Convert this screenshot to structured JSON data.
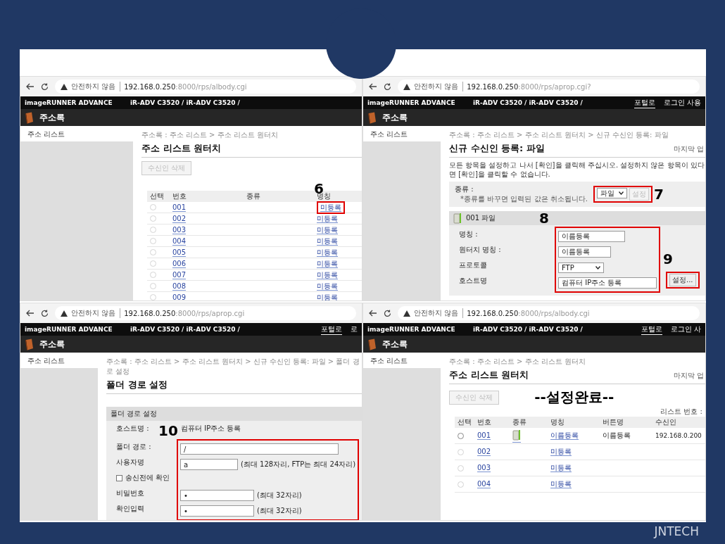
{
  "panels": [
    {
      "kind": "address_list",
      "browser": {
        "security": "안전하지 않음",
        "url_host": "192.168.0.250",
        "url_path": ":8000/rps/albody.cgi"
      },
      "header": {
        "product": "imageRUNNER ADVANCE",
        "device": "iR-ADV C3520 / iR-ADV C3520 /"
      },
      "app_title": "주소록",
      "sidebar_item": "주소 리스트",
      "breadcrumb": "주소록 : 주소 리스트 > 주소 리스트 원터치",
      "title": "주소 리스트 원터치",
      "delete_button": {
        "label": "수신인 삭제",
        "disabled": true
      },
      "columns": [
        "선택",
        "번호",
        "종류",
        "명칭"
      ],
      "rows": [
        {
          "number": "001",
          "name": "미등록",
          "disabled": true,
          "callout": "6"
        },
        {
          "number": "002",
          "name": "미등록",
          "disabled": true
        },
        {
          "number": "003",
          "name": "미등록",
          "disabled": true
        },
        {
          "number": "004",
          "name": "미등록",
          "disabled": true
        },
        {
          "number": "005",
          "name": "미등록",
          "disabled": true
        },
        {
          "number": "006",
          "name": "미등록",
          "disabled": true
        },
        {
          "number": "007",
          "name": "미등록",
          "disabled": true
        },
        {
          "number": "008",
          "name": "미등록",
          "disabled": true
        },
        {
          "number": "009",
          "name": "미등록",
          "disabled": true
        }
      ]
    },
    {
      "kind": "new_recipient",
      "browser": {
        "security": "안전하지 않음",
        "url_host": "192.168.0.250",
        "url_path": ":8000/rps/aprop.cgi?"
      },
      "header": {
        "product": "imageRUNNER ADVANCE",
        "device": "iR-ADV C3520 / iR-ADV C3520 /",
        "links": [
          "포털로",
          "로그인 사용"
        ]
      },
      "app_title": "주소록",
      "sidebar_item": "주소 리스트",
      "breadcrumb": "주소록 : 주소 리스트 > 주소 리스트 원터치 > 신규 수신인 등록: 파일",
      "title": "신규 수신인 등록: 파일",
      "last_update": "마지막 업",
      "instructions": "모든 항목을 설정하고 나서 [확인]을 클릭해 주십시오. 설정하지 않은 항목이 있다면 [확인]을 클릭할 수 없습니다.",
      "type_field": {
        "label": "종류 :",
        "note": "*종류를 바꾸면 입력된 값은 취소됩니다.",
        "value": "파일",
        "button": {
          "label": "설정",
          "disabled": true
        },
        "callout": "7"
      },
      "section_title": "001 파일",
      "fields_callout": "8",
      "fields": [
        {
          "kind": "input",
          "label": "명칭 :",
          "value": "이름등록"
        },
        {
          "kind": "input",
          "label": "원터치 명칭 :",
          "value": "이름등록"
        },
        {
          "kind": "select",
          "label": "프로토콜",
          "value": "FTP"
        },
        {
          "kind": "input",
          "label": "호스트명",
          "value": "컴퓨터 IP주소 등록"
        }
      ],
      "host_button": {
        "label": "설정...",
        "callout": "9"
      }
    },
    {
      "kind": "folder_path",
      "browser": {
        "security": "안전하지 않음",
        "url_host": "192.168.0.250",
        "url_path": ":8000/rps/aprop.cgi"
      },
      "header": {
        "product": "imageRUNNER ADVANCE",
        "device": "iR-ADV C3520 / iR-ADV C3520 /",
        "links": [
          "포털로",
          "로"
        ]
      },
      "app_title": "주소록",
      "sidebar_item": "주소 리스트",
      "breadcrumb": "주소록 : 주소 리스트 > 주소 리스트 원터치 > 신규 수신인 등록: 파일 > 폴더 경로 설정",
      "title": "폴더 경로 설정",
      "section_title": "폴더 경로 설정",
      "host_label": "호스트명 :",
      "host_value": "컴퓨터 IP주소 등록",
      "fields_callout": "10",
      "fields": [
        {
          "kind": "input",
          "label": "폴더 경로 :",
          "value": "/"
        },
        {
          "kind": "input",
          "label": "사용자명",
          "value": "a",
          "note": "(최대 128자리, FTP는 최대 24자리)"
        },
        {
          "kind": "checkbox",
          "label": "송신전에 확인",
          "checked": false
        },
        {
          "kind": "password",
          "label": "비밀번호",
          "value": "•",
          "note": "(최대 32자리)"
        },
        {
          "kind": "password",
          "label": "확인입력",
          "value": "•",
          "note": "(최대 32자리)"
        }
      ]
    },
    {
      "kind": "address_list",
      "browser": {
        "security": "안전하지 않음",
        "url_host": "192.168.0.250",
        "url_path": ":8000/rps/albody.cgi"
      },
      "header": {
        "product": "imageRUNNER ADVANCE",
        "device": "iR-ADV C3520 / iR-ADV C3520 /",
        "links": [
          "포털로",
          "로그인 사"
        ]
      },
      "app_title": "주소록",
      "sidebar_item": "주소 리스트",
      "breadcrumb": "주소록 : 주소 리스트 > 주소 리스트 원터치",
      "title": "주소 리스트 원터치",
      "last_update": "마지막 업",
      "delete_button": {
        "label": "수신인 삭제",
        "disabled": true
      },
      "banner": "--설정완료--",
      "list_number_label": "리스트 번호 :",
      "columns": [
        "선택",
        "번호",
        "종류",
        "명칭",
        "버튼명",
        "수신인"
      ],
      "rows": [
        {
          "number": "001",
          "kind": "file",
          "name": "이름등록",
          "button_name": "이름등록",
          "recipient": "192.168.0.200",
          "disabled": false
        },
        {
          "number": "002",
          "kind": "empty",
          "name": "미등록",
          "disabled": true
        },
        {
          "number": "003",
          "kind": "empty",
          "name": "미등록",
          "disabled": true
        },
        {
          "number": "004",
          "kind": "empty",
          "name": "미등록",
          "disabled": true
        }
      ]
    }
  ],
  "footer": "JNTECH"
}
